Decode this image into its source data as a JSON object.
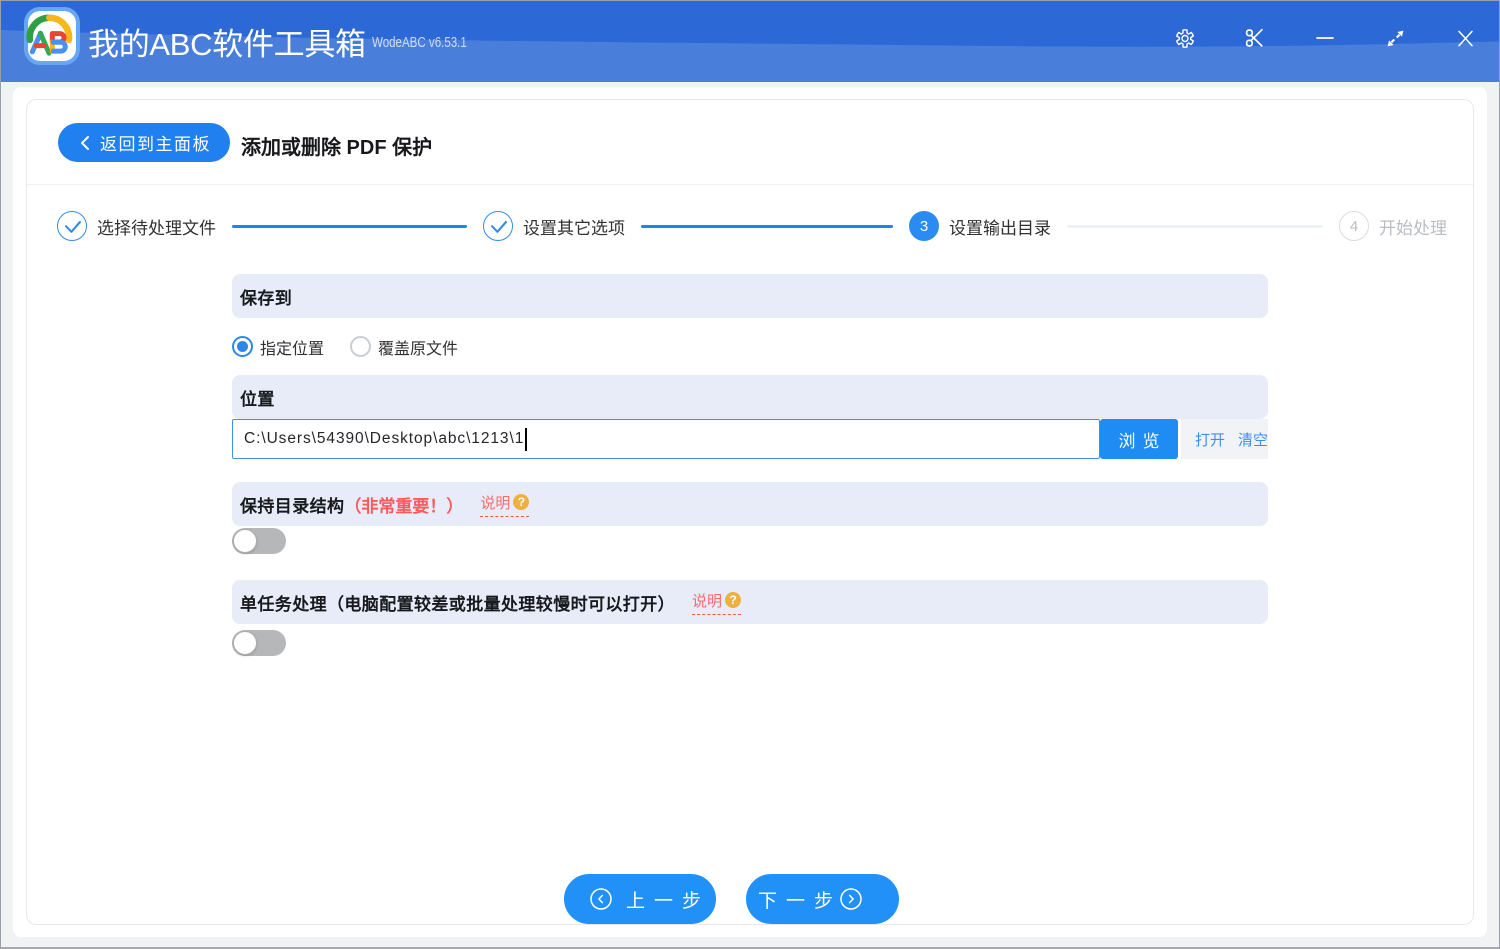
{
  "window": {
    "title": "我的ABC软件工具箱",
    "version": "WodeABC v6.53.1",
    "controls": [
      "settings",
      "screenshot",
      "minimize",
      "maximize",
      "close"
    ]
  },
  "header": {
    "back_label": "返回到主面板",
    "page_title": "添加或删除 PDF 保护"
  },
  "steps": [
    {
      "number": "1",
      "label": "选择待处理文件",
      "state": "done"
    },
    {
      "number": "2",
      "label": "设置其它选项",
      "state": "done"
    },
    {
      "number": "3",
      "label": "设置输出目录",
      "state": "active"
    },
    {
      "number": "4",
      "label": "开始处理",
      "state": "todo"
    }
  ],
  "form": {
    "save_to": {
      "title": "保存到",
      "options": [
        {
          "label": "指定位置",
          "selected": true
        },
        {
          "label": "覆盖原文件",
          "selected": false
        }
      ]
    },
    "location": {
      "title": "位置",
      "value": "C:\\Users\\54390\\Desktop\\abc\\1213\\1",
      "browse_label": "浏览",
      "open_label": "打开",
      "clear_label": "清空"
    },
    "keep_structure": {
      "title": "保持目录结构",
      "note": "（非常重要！）",
      "help_label": "说明",
      "enabled": false
    },
    "single_task": {
      "title": "单任务处理（电脑配置较差或批量处理较慢时可以打开）",
      "help_label": "说明",
      "enabled": false
    }
  },
  "footer": {
    "prev_label": "上一步",
    "next_label": "下一步"
  },
  "colors": {
    "titlebar": "#2c69d6",
    "primary_blue": "#2080f0",
    "band_bg": "#e7ecf8",
    "danger_red": "#fb5a5c",
    "link_blue": "#3f8df3"
  }
}
